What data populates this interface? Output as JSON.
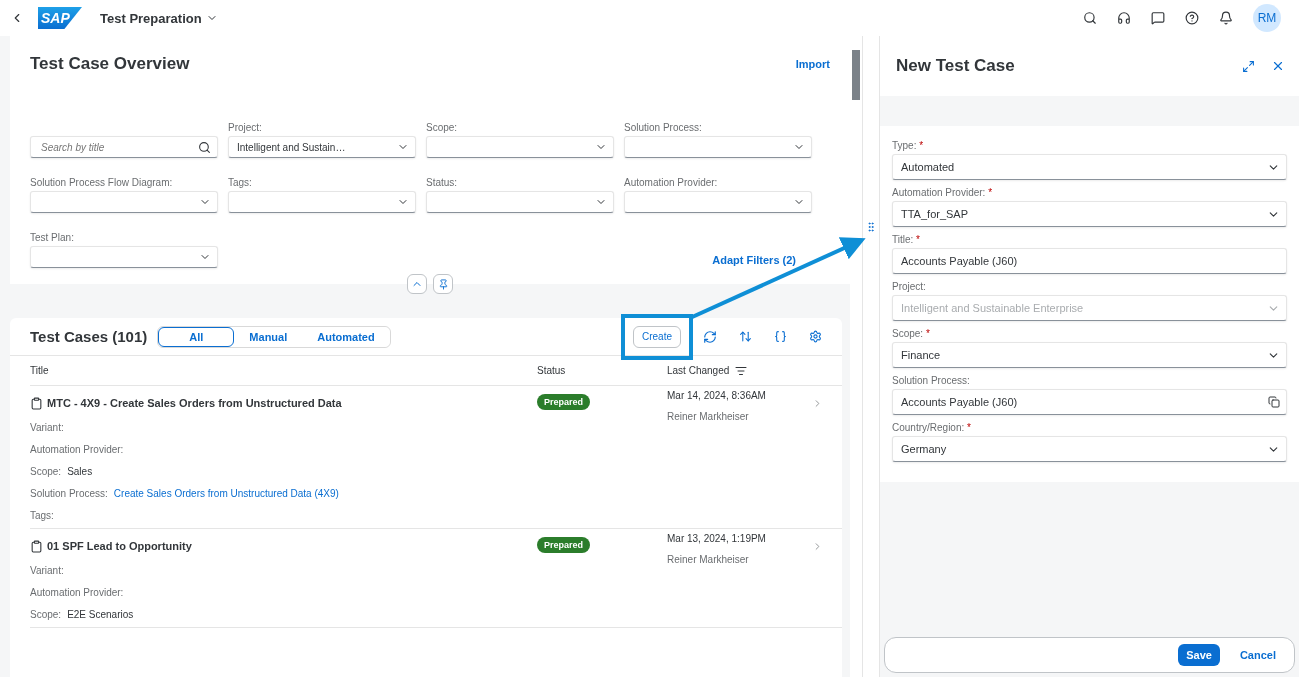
{
  "shell": {
    "logo": "SAP",
    "title": "Test Preparation",
    "avatar": "RM"
  },
  "page": {
    "title": "Test Case Overview",
    "action": "Import"
  },
  "filters": [
    {
      "kind": "search",
      "placeholder": "Search by title"
    },
    {
      "kind": "select",
      "label": "Project:",
      "value": "Intelligent and Sustain…"
    },
    {
      "kind": "select",
      "label": "Scope:"
    },
    {
      "kind": "select",
      "label": "Solution Process:"
    },
    {
      "kind": "select",
      "label": "Solution Process Flow Diagram:"
    },
    {
      "kind": "select",
      "label": "Tags:"
    },
    {
      "kind": "select",
      "label": "Status:"
    },
    {
      "kind": "select",
      "label": "Automation Provider:"
    },
    {
      "kind": "select",
      "label": "Test Plan:"
    }
  ],
  "adapt_filters": "Adapt Filters (2)",
  "table": {
    "title": "Test Cases (101)",
    "segments": [
      {
        "label": "All",
        "selected": true
      },
      {
        "label": "Manual",
        "selected": false
      },
      {
        "label": "Automated",
        "selected": false
      }
    ],
    "create": "Create",
    "columns": [
      "Title",
      "Status",
      "Last Changed"
    ],
    "rows": [
      {
        "title": "MTC - 4X9 - Create Sales Orders from Unstructured Data",
        "status": "Prepared",
        "date": "Mar 14, 2024, 8:36AM",
        "author": "Reiner Markheiser",
        "details": [
          {
            "label": "Variant:"
          },
          {
            "label": "Automation Provider:"
          },
          {
            "label": "Scope:",
            "value": "Sales"
          },
          {
            "label": "Solution Process:",
            "value": "Create Sales Orders from Unstructured Data (4X9)",
            "link": true
          },
          {
            "label": "Tags:"
          }
        ]
      },
      {
        "title": "01 SPF Lead to Opportunity",
        "status": "Prepared",
        "date": "Mar 13, 2024, 1:19PM",
        "author": "Reiner Markheiser",
        "details": [
          {
            "label": "Variant:"
          },
          {
            "label": "Automation Provider:"
          },
          {
            "label": "Scope:",
            "value": "E2E Scenarios"
          }
        ]
      }
    ]
  },
  "panel": {
    "title": "New Test Case",
    "required_mark": "*",
    "fields": [
      {
        "label": "Type:",
        "required": true,
        "kind": "select",
        "value": "Automated",
        "disabled": false
      },
      {
        "label": "Automation Provider:",
        "required": true,
        "kind": "select",
        "value": "TTA_for_SAP",
        "disabled": false
      },
      {
        "label": "Title:",
        "required": true,
        "kind": "text",
        "value": "Accounts Payable (J60)",
        "disabled": false
      },
      {
        "label": "Project:",
        "required": false,
        "kind": "select",
        "value": "Intelligent and Sustainable Enterprise",
        "disabled": true
      },
      {
        "label": "Scope:",
        "required": true,
        "kind": "select",
        "value": "Finance",
        "disabled": false
      },
      {
        "label": "Solution Process:",
        "required": false,
        "kind": "valuehelp",
        "value": "Accounts Payable (J60)",
        "disabled": false
      },
      {
        "label": "Country/Region:",
        "required": true,
        "kind": "select",
        "value": "Germany",
        "disabled": false
      }
    ],
    "buttons": [
      {
        "label": "Save",
        "kind": "primary"
      },
      {
        "label": "Cancel",
        "kind": "transparent"
      }
    ]
  }
}
